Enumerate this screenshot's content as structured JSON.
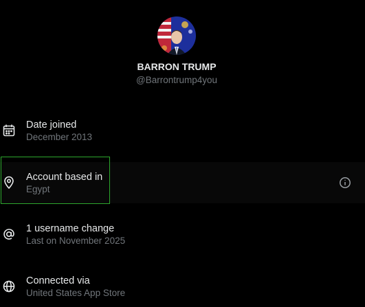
{
  "profile": {
    "display_name": "BARRON TRUMP",
    "handle": "@Barrontrump4you",
    "avatar_icon": "profile-photo"
  },
  "about_rows": [
    {
      "icon": "calendar-icon",
      "title": "Date joined",
      "subtitle": "December 2013"
    },
    {
      "icon": "location-pin-icon",
      "title": "Account based in",
      "subtitle": "Egypt",
      "trailing_icon": "info-icon"
    },
    {
      "icon": "at-sign-icon",
      "title": "1 username change",
      "subtitle": "Last on November 2025"
    },
    {
      "icon": "globe-icon",
      "title": "Connected via",
      "subtitle": "United States App Store"
    }
  ],
  "colors": {
    "background": "#000000",
    "primary_text": "#e7e9ea",
    "secondary_text": "#71767b",
    "highlight_border": "#2da82d"
  }
}
